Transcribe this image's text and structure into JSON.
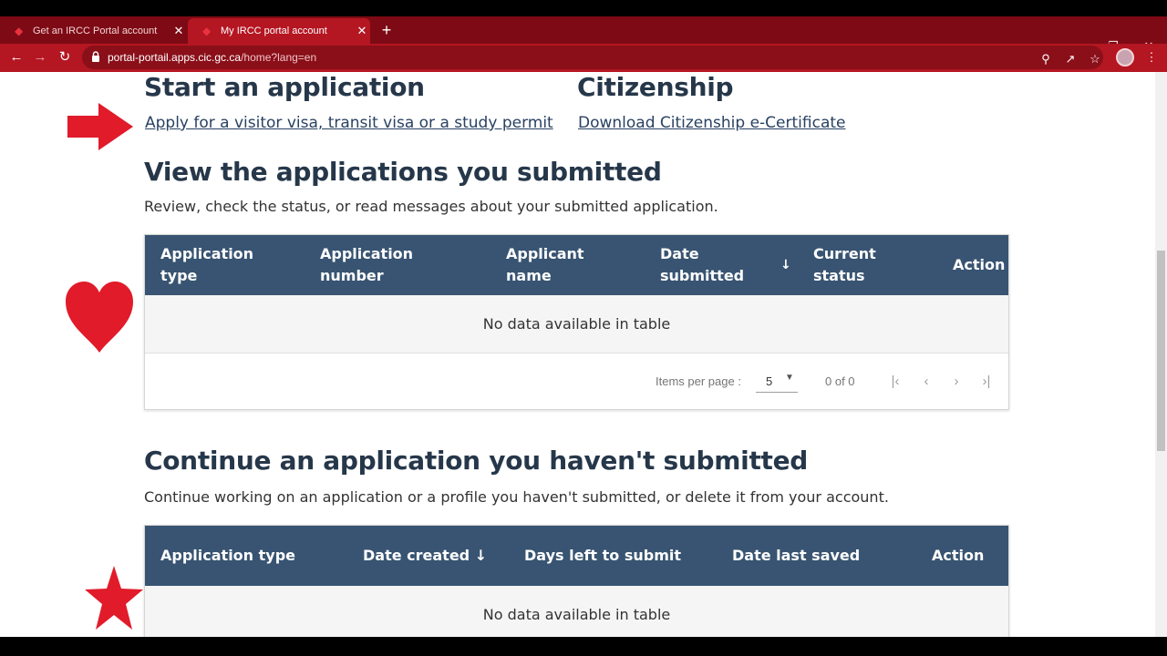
{
  "browser": {
    "tabs": [
      {
        "title": "Get an IRCC Portal account",
        "active": false
      },
      {
        "title": "My IRCC portal account",
        "active": true
      }
    ],
    "url_host": "portal-portail.apps.cic.gc.ca",
    "url_path": "/home?lang=en"
  },
  "start": {
    "heading": "Start an application",
    "link": "Apply for a visitor visa, transit visa or a study permit"
  },
  "citizenship": {
    "heading": "Citizenship",
    "link": "Download Citizenship e-Certificate"
  },
  "submitted": {
    "heading": "View the applications you submitted",
    "description": "Review, check the status, or read messages about your submitted application.",
    "columns": [
      {
        "line1": "Application",
        "line2": "type"
      },
      {
        "line1": "Application",
        "line2": "number"
      },
      {
        "line1": "Applicant",
        "line2": "name"
      },
      {
        "line1": "Date",
        "line2": "submitted"
      },
      {
        "line1": "Current",
        "line2": "status"
      },
      {
        "line1": "Action",
        "line2": ""
      }
    ],
    "empty": "No data available in table",
    "pager": {
      "items_label": "Items per page :",
      "items_value": "5",
      "range": "0 of 0"
    }
  },
  "unsubmitted": {
    "heading": "Continue an application you haven't submitted",
    "description": "Continue working on an application or a profile you haven't submitted, or delete it from your account.",
    "columns": [
      "Application type",
      "Date created ↓",
      "Days left to submit",
      "Date last saved",
      "Action"
    ],
    "empty": "No data available in table"
  },
  "colors": {
    "tab_bar": "#7d0a14",
    "toolbar": "#b41622",
    "table_header": "#385472",
    "annotation_red": "#e11b2a"
  }
}
